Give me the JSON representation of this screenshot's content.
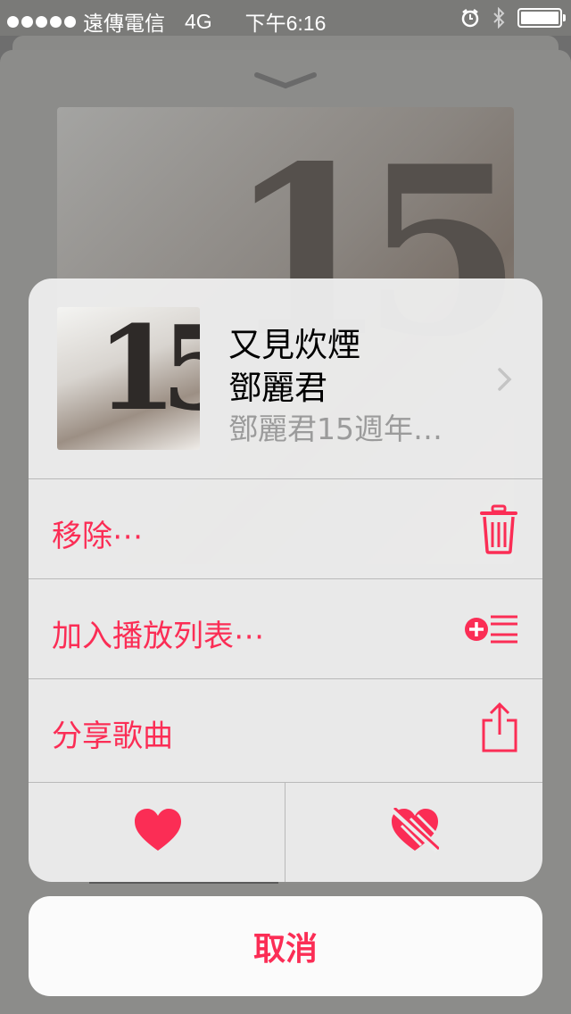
{
  "status_bar": {
    "carrier": "遠傳電信",
    "network": "4G",
    "time": "下午6:16",
    "battery_level": 1.0
  },
  "song": {
    "title": "又見炊煙",
    "artist": "鄧麗君",
    "album": "鄧麗君15週年…"
  },
  "actions": [
    {
      "label": "移除⋯",
      "icon": "trash-icon"
    },
    {
      "label": "加入播放列表⋯",
      "icon": "add-to-playlist-icon"
    },
    {
      "label": "分享歌曲",
      "icon": "share-icon"
    }
  ],
  "love_row": {
    "love_icon": "heart-icon",
    "dislike_icon": "dislike-heart-icon"
  },
  "cancel_label": "取消",
  "colors": {
    "accent": "#fb2d55",
    "sheet_bg": "#ececec",
    "secondary_text": "#9b9b9b"
  }
}
